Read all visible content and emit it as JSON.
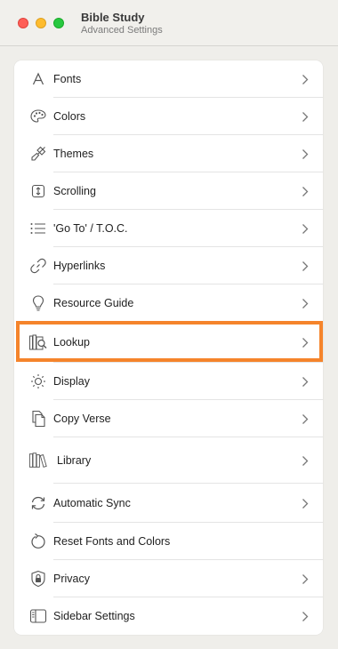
{
  "window": {
    "title": "Bible Study",
    "subtitle": "Advanced Settings"
  },
  "colors": {
    "highlight": "#f5842b",
    "close": "#fe5f57",
    "minimize": "#febc2e",
    "maximize": "#28c840"
  },
  "settings": {
    "items": [
      {
        "label": "Fonts",
        "icon": "font-icon",
        "chevron": true
      },
      {
        "label": "Colors",
        "icon": "palette-icon",
        "chevron": true
      },
      {
        "label": "Themes",
        "icon": "paintbrush-icon",
        "chevron": true
      },
      {
        "label": "Scrolling",
        "icon": "scroll-icon",
        "chevron": true
      },
      {
        "label": "'Go To' / T.O.C.",
        "icon": "list-icon",
        "chevron": true
      },
      {
        "label": "Hyperlinks",
        "icon": "link-icon",
        "chevron": true
      },
      {
        "label": "Resource Guide",
        "icon": "lightbulb-icon",
        "chevron": true
      },
      {
        "label": "Lookup",
        "icon": "lookup-icon",
        "chevron": true,
        "highlighted": true
      },
      {
        "label": "Display",
        "icon": "brightness-icon",
        "chevron": true
      },
      {
        "label": "Copy Verse",
        "icon": "copy-icon",
        "chevron": true
      },
      {
        "label": "Library",
        "icon": "books-icon",
        "chevron": true
      },
      {
        "label": "Automatic Sync",
        "icon": "sync-icon",
        "chevron": true
      },
      {
        "label": "Reset Fonts and Colors",
        "icon": "reset-icon",
        "chevron": false
      },
      {
        "label": "Privacy",
        "icon": "lock-shield-icon",
        "chevron": true
      },
      {
        "label": "Sidebar Settings",
        "icon": "sidebar-icon",
        "chevron": true
      }
    ]
  }
}
